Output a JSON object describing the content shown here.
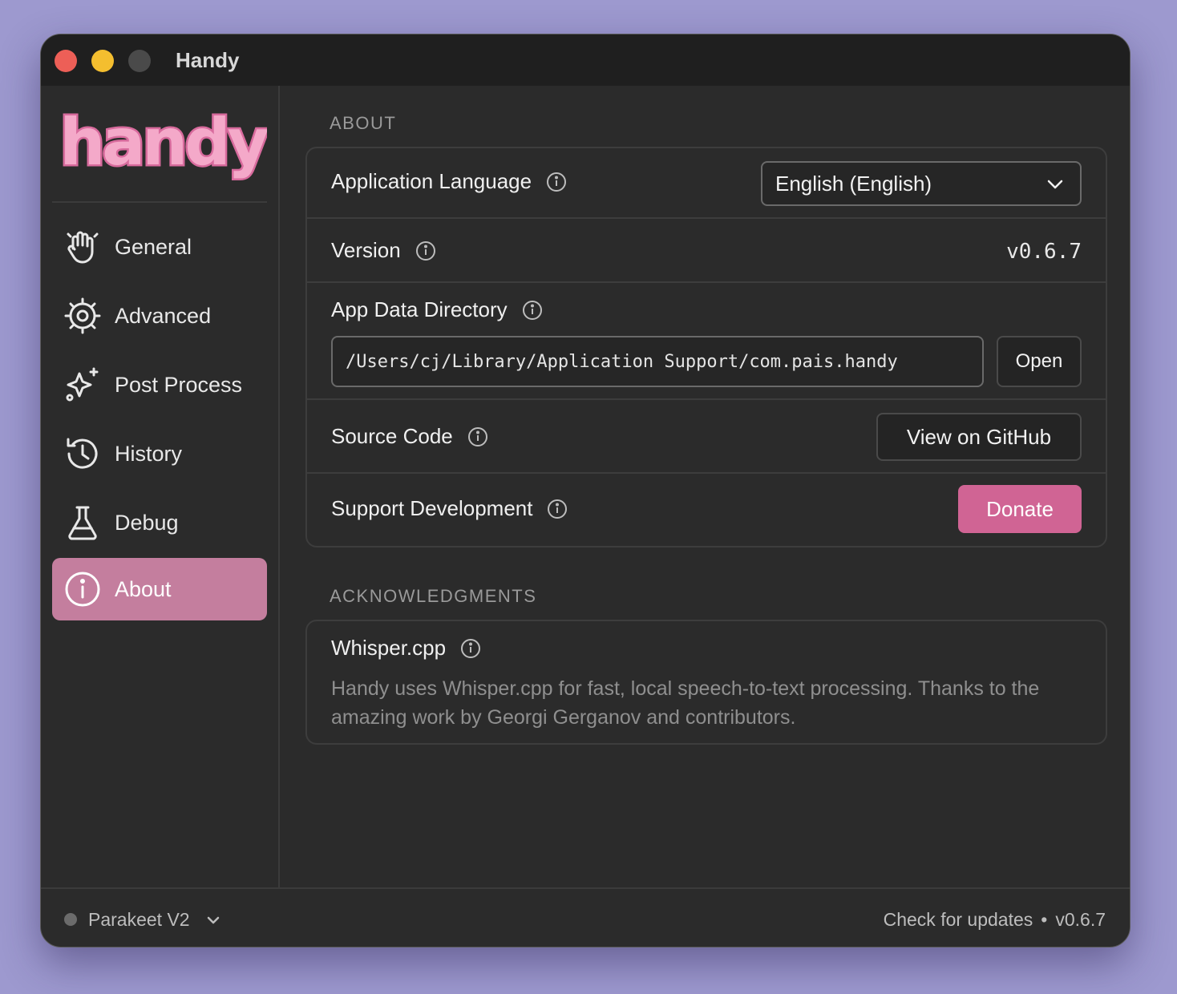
{
  "window": {
    "title": "Handy"
  },
  "sidebar": {
    "logo_text": "handy",
    "items": [
      {
        "label": "General",
        "icon": "hand-icon"
      },
      {
        "label": "Advanced",
        "icon": "gear-icon"
      },
      {
        "label": "Post Process",
        "icon": "sparkle-icon"
      },
      {
        "label": "History",
        "icon": "history-icon"
      },
      {
        "label": "Debug",
        "icon": "flask-icon"
      },
      {
        "label": "About",
        "icon": "info-icon",
        "active": true
      }
    ]
  },
  "about": {
    "section_title": "ABOUT",
    "language_label": "Application Language",
    "language_value": "English (English)",
    "version_label": "Version",
    "version_value": "v0.6.7",
    "data_dir_label": "App Data Directory",
    "data_dir_value": "/Users/cj/Library/Application Support/com.pais.handy",
    "open_button": "Open",
    "source_label": "Source Code",
    "github_button": "View on GitHub",
    "support_label": "Support Development",
    "donate_button": "Donate"
  },
  "acknowledgments": {
    "section_title": "ACKNOWLEDGMENTS",
    "title": "Whisper.cpp",
    "description": "Handy uses Whisper.cpp for fast, local speech-to-text processing. Thanks to the amazing work by Georgi Gerganov and contributors."
  },
  "footer": {
    "model": "Parakeet V2",
    "check_updates": "Check for updates",
    "separator": "•",
    "version": "v0.6.7"
  },
  "colors": {
    "background": "#9d99cf",
    "window": "#2b2b2b",
    "accent_pink": "#d06494",
    "active_nav": "#c47e9e"
  }
}
